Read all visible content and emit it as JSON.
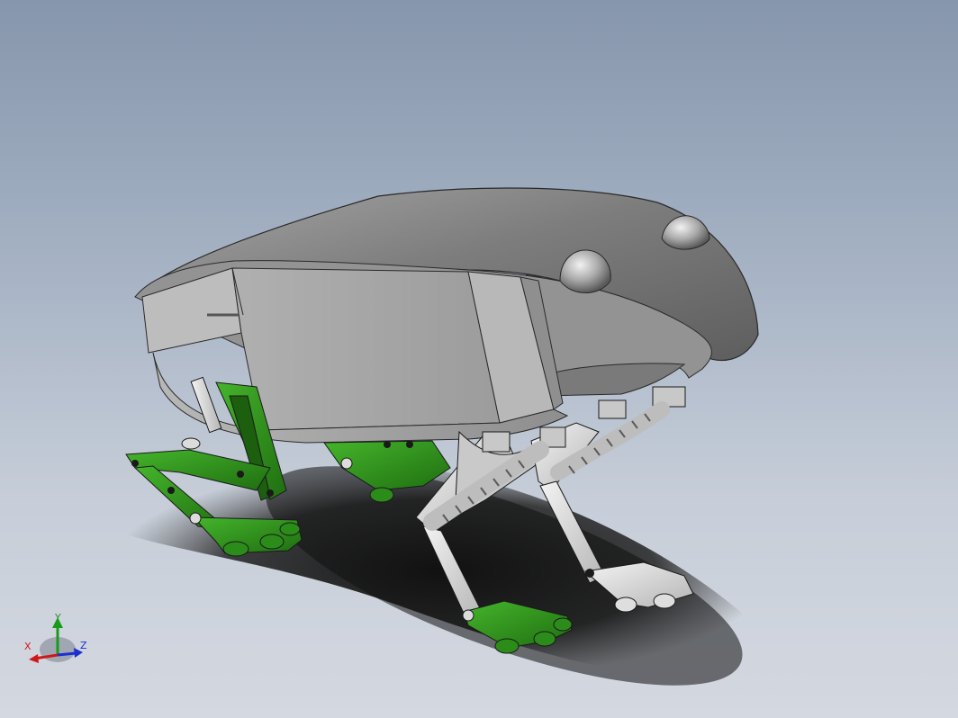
{
  "viewport": {
    "background_top": "#8696ac",
    "background_bottom": "#d4d8e0"
  },
  "model": {
    "shell_color": "#8a8a8a",
    "panel_color": "#a9a9a9",
    "green_part_color": "#2f8f1c",
    "light_part_color": "#d8d8d8",
    "shadow_color": "#1e1e1e"
  },
  "triad": {
    "x_label": "X",
    "y_label": "Y",
    "z_label": "Z",
    "x_color": "#d01818",
    "y_color": "#1a9a1a",
    "z_color": "#1a30d0"
  }
}
